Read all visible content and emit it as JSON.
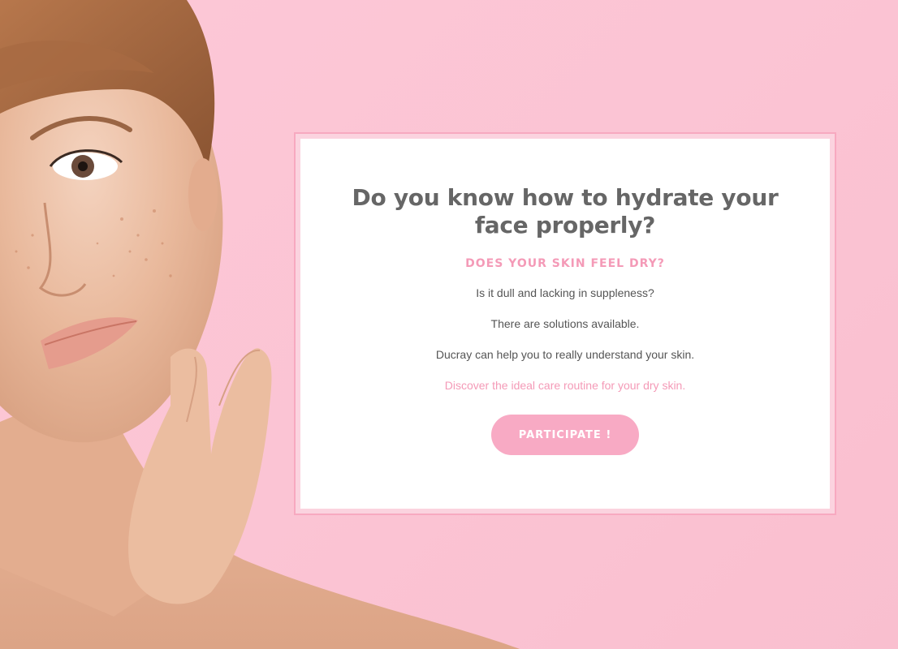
{
  "colors": {
    "background": "#fbc6d5",
    "accent": "#f49ab7",
    "button": "#f8aac4",
    "heading": "#666666"
  },
  "hero_image": {
    "icon": "woman-portrait-image"
  },
  "card": {
    "headline": "Do you know how to hydrate your face properly?",
    "subheading": "DOES YOUR SKIN FEEL DRY?",
    "paragraphs": [
      "Is it dull and lacking in suppleness?",
      "There are solutions available.",
      "Ducray can help you to really understand your skin."
    ],
    "accent_text": "Discover the ideal care routine for your dry skin.",
    "cta_label": "PARTICIPATE !"
  }
}
